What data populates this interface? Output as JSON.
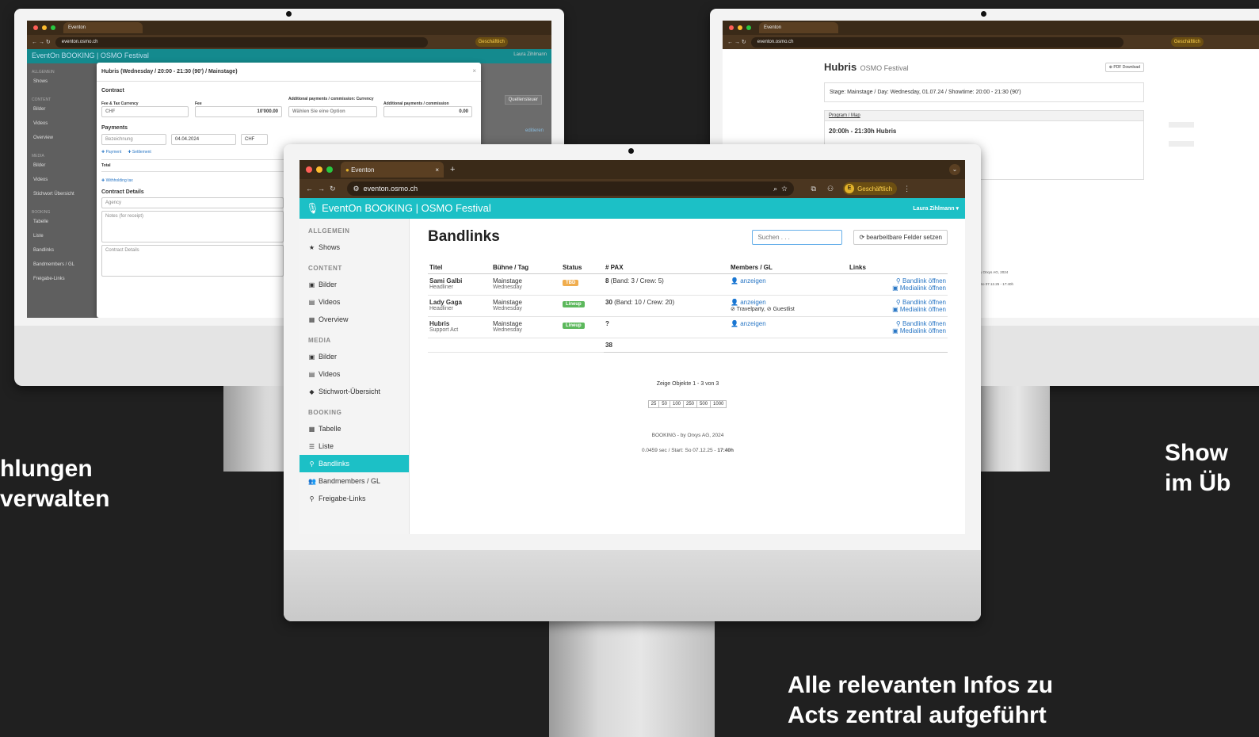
{
  "captions": {
    "left_line1": "hlungen",
    "left_line2": "verwalten",
    "right_line1": "Show",
    "right_line2": "im Üb",
    "bottom_line1": "Alle relevanten Infos zu",
    "bottom_line2": "Acts zentral aufgeführt"
  },
  "browser": {
    "tab_title": "Eventon",
    "url": "eventon.osmo.ch",
    "profile_badge": "Geschäftlich",
    "profile_initial": "E"
  },
  "app": {
    "brand": "EventOn BOOKING | OSMO Festival",
    "user": "Laura Zihlmann",
    "sidebar": {
      "sections": [
        {
          "title": "ALLGEMEIN",
          "items": [
            {
              "label": "Shows",
              "icon": "★"
            }
          ]
        },
        {
          "title": "CONTENT",
          "items": [
            {
              "label": "Bilder",
              "icon": "▣"
            },
            {
              "label": "Videos",
              "icon": "▤"
            },
            {
              "label": "Overview",
              "icon": "▦"
            }
          ]
        },
        {
          "title": "MEDIA",
          "items": [
            {
              "label": "Bilder",
              "icon": "▣"
            },
            {
              "label": "Videos",
              "icon": "▤"
            },
            {
              "label": "Stichwort-Übersicht",
              "icon": "◆"
            }
          ]
        },
        {
          "title": "BOOKING",
          "items": [
            {
              "label": "Tabelle",
              "icon": "▦"
            },
            {
              "label": "Liste",
              "icon": "☰"
            },
            {
              "label": "Bandlinks",
              "icon": "⚲"
            },
            {
              "label": "Bandmembers / GL",
              "icon": "👥"
            },
            {
              "label": "Freigabe-Links",
              "icon": "⚲"
            }
          ]
        }
      ]
    },
    "page_title": "Bandlinks",
    "search_placeholder": "Suchen . . .",
    "editable_button": "bearbeitbare Felder setzen",
    "table": {
      "headers": [
        "Titel",
        "Bühne / Tag",
        "Status",
        "# PAX",
        "Members / GL",
        "Links"
      ],
      "rows": [
        {
          "title": "Sami Galbi",
          "role": "Headliner",
          "stage": "Mainstage",
          "day": "Wednesday",
          "status": "TBD",
          "status_color": "#f0ad4e",
          "pax": "8",
          "pax_detail": " (Band: 3 / Crew: 5)",
          "members": "anzeigen",
          "members_extra": "",
          "link1": "Bandlink öffnen",
          "link2": "Medialink öffnen"
        },
        {
          "title": "Lady Gaga",
          "role": "Headliner",
          "stage": "Mainstage",
          "day": "Wednesday",
          "status": "Lineup",
          "status_color": "#5cb85c",
          "pax": "30",
          "pax_detail": " (Band: 10 / Crew: 20)",
          "members": "anzeigen",
          "members_extra": "⊘ Travelparty, ⊘ Guestlist",
          "link1": "Bandlink öffnen",
          "link2": "Medialink öffnen"
        },
        {
          "title": "Hubris",
          "role": "Support Act",
          "stage": "Mainstage",
          "day": "Wednesday",
          "status": "Lineup",
          "status_color": "#5cb85c",
          "pax": "?",
          "pax_detail": "",
          "members": "anzeigen",
          "members_extra": "",
          "link1": "Bandlink öffnen",
          "link2": "Medialink öffnen"
        }
      ],
      "total": "38"
    },
    "pagination_text": "Zeige Objekte 1 - 3 von 3",
    "page_sizes": [
      "25",
      "50",
      "100",
      "250",
      "500",
      "1000"
    ],
    "footer1": "BOOKING - by Orxys AG, 2024",
    "footer2_prefix": "0.0459 sec / Start: So 07.12.25 - ",
    "footer2_bold": "17:40h"
  },
  "left_window": {
    "modal_title": "Hubris (Wednesday / 20:00 - 21:30 (90') / Mainstage)",
    "contract": "Contract",
    "fee_currency_label": "Fee & Tax Currency",
    "fee_label": "Fee",
    "add_pay_currency_label": "Additional payments / commission: Currency",
    "add_pay_label": "Additional payments / commission",
    "currency_value": "CHF",
    "fee_value": "10'000.00",
    "add_currency_placeholder": "Wählen Sie eine Option",
    "add_value": "0.00",
    "payments": "Payments",
    "pay_desc": "Bezeichnung",
    "pay_date": "04.04.2024",
    "pay_cur": "CHF",
    "add_payment": "Payment",
    "add_settlement": "Settlement",
    "total": "Total",
    "withholding": "Withholding tax",
    "contract_details": "Contract Details",
    "agency": "Agency",
    "notes": "Notes (for receipt)",
    "contract_details_ph": "Contract Details",
    "edit1": "editieren",
    "edit2": "editieren",
    "quellensteuer": "Quellensteuer",
    "bg_brand": "EventOn BOOKING | OSMO Festival",
    "bg_user": "Laura Zihlmann",
    "sidebar": [
      "ALLGEMEIN",
      "Shows",
      "CONTENT",
      "Bilder",
      "Videos",
      "Overview",
      "MEDIA",
      "Bilder",
      "Videos",
      "Stichwort Übersicht",
      "BOOKING",
      "Tabelle",
      "Liste",
      "Bandlinks",
      "Bandmembers / GL",
      "Freigabe-Links"
    ]
  },
  "right_window": {
    "title": "Hubris",
    "subtitle": "OSMO Festival",
    "pdf_button": "PDF Download",
    "info": "Stage: Mainstage / Day: Wednesday, 01.07.24 / Showtime: 20:00 - 21:30 (90')",
    "program_heading": "Program / Map",
    "program_item": "20:00h - 21:30h Hubris",
    "footer1": "y Orxys AG, 2024",
    "footer2": "So 07.12.25 - 17:40h"
  }
}
